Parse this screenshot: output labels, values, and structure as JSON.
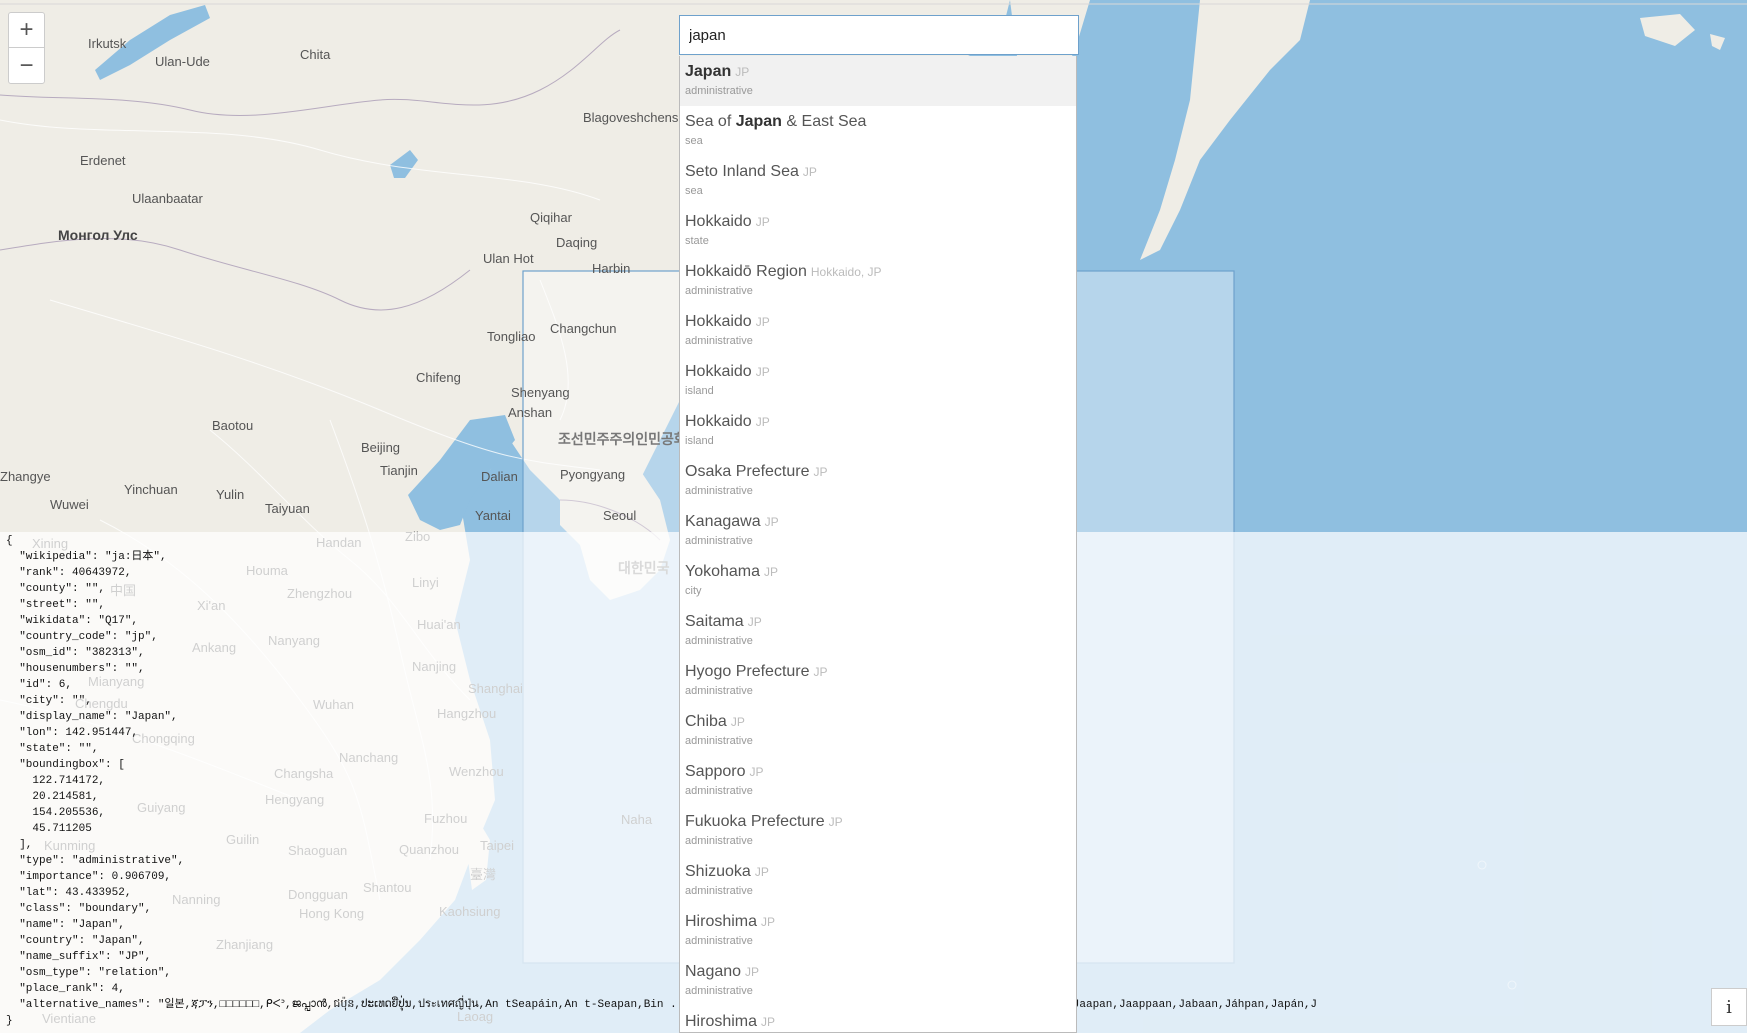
{
  "search": {
    "value": "japan"
  },
  "zoom": {
    "in_label": "+",
    "out_label": "−"
  },
  "info": {
    "label": "i"
  },
  "results": [
    {
      "pre": "",
      "bold": "Japan",
      "post": "",
      "cc": "JP",
      "type": "administrative",
      "active": true
    },
    {
      "pre": "Sea of ",
      "bold": "Japan",
      "post": " & East Sea",
      "cc": "",
      "type": "sea"
    },
    {
      "pre": "Seto Inland Sea",
      "bold": "",
      "post": "",
      "cc": "JP",
      "type": "sea"
    },
    {
      "pre": "Hokkaido",
      "bold": "",
      "post": "",
      "cc": "JP",
      "type": "state"
    },
    {
      "pre": "Hokkaidō Region",
      "bold": "",
      "post": "",
      "cc": "Hokkaido, JP",
      "type": "administrative"
    },
    {
      "pre": "Hokkaido",
      "bold": "",
      "post": "",
      "cc": "JP",
      "type": "administrative"
    },
    {
      "pre": "Hokkaido",
      "bold": "",
      "post": "",
      "cc": "JP",
      "type": "island"
    },
    {
      "pre": "Hokkaido",
      "bold": "",
      "post": "",
      "cc": "JP",
      "type": "island"
    },
    {
      "pre": "Osaka Prefecture",
      "bold": "",
      "post": "",
      "cc": "JP",
      "type": "administrative"
    },
    {
      "pre": "Kanagawa",
      "bold": "",
      "post": "",
      "cc": "JP",
      "type": "administrative"
    },
    {
      "pre": "Yokohama",
      "bold": "",
      "post": "",
      "cc": "JP",
      "type": "city"
    },
    {
      "pre": "Saitama",
      "bold": "",
      "post": "",
      "cc": "JP",
      "type": "administrative"
    },
    {
      "pre": "Hyogo Prefecture",
      "bold": "",
      "post": "",
      "cc": "JP",
      "type": "administrative"
    },
    {
      "pre": "Chiba",
      "bold": "",
      "post": "",
      "cc": "JP",
      "type": "administrative"
    },
    {
      "pre": "Sapporo",
      "bold": "",
      "post": "",
      "cc": "JP",
      "type": "administrative"
    },
    {
      "pre": "Fukuoka Prefecture",
      "bold": "",
      "post": "",
      "cc": "JP",
      "type": "administrative"
    },
    {
      "pre": "Shizuoka",
      "bold": "",
      "post": "",
      "cc": "JP",
      "type": "administrative"
    },
    {
      "pre": "Hiroshima",
      "bold": "",
      "post": "",
      "cc": "JP",
      "type": "administrative"
    },
    {
      "pre": "Nagano",
      "bold": "",
      "post": "",
      "cc": "JP",
      "type": "administrative"
    },
    {
      "pre": "Hiroshima",
      "bold": "",
      "post": "",
      "cc": "JP",
      "type": ""
    }
  ],
  "json_text": "{\n  \"wikipedia\": \"ja:日本\",\n  \"rank\": 40643972,\n  \"county\": \"\",\n  \"street\": \"\",\n  \"wikidata\": \"Q17\",\n  \"country_code\": \"jp\",\n  \"osm_id\": \"382313\",\n  \"housenumbers\": \"\",\n  \"id\": 6,\n  \"city\": \"\",\n  \"display_name\": \"Japan\",\n  \"lon\": 142.951447,\n  \"state\": \"\",\n  \"boundingbox\": [\n    122.714172,\n    20.214581,\n    154.205536,\n    45.711205\n  ],\n  \"type\": \"administrative\",\n  \"importance\": 0.906709,\n  \"lat\": 43.433952,\n  \"class\": \"boundary\",\n  \"name\": \"Japan\",\n  \"country\": \"Japan\",\n  \"name_suffix\": \"JP\",\n  \"osm_type\": \"relation\",\n  \"place_rank\": 4,\n  \"alternative_names\": \"일본,ጃፓን,□□□□□□,ᑭᐸᐣ,ജപ്പാൻ,ជប៉ុន,ປະເທດຍີ່ປຸ່ນ,ประเทศญี่ปุ่น,An tSeapáin,An t-Seapan,Bin ... appone,Giapun,Hapõ,Hapon,Iapani,Iaponia,IJapani,IJaphani,Jaapan,Jaappaan,Jabaan,Jáhpan,Japán,J\n}",
  "map_labels": [
    {
      "t": "Irkutsk"
    },
    {
      "t": "Chita"
    },
    {
      "t": "Ulan-Ude"
    },
    {
      "t": "Blagoveshchensk"
    },
    {
      "t": "Erdenet"
    },
    {
      "t": "Ulaanbaatar"
    },
    {
      "t": "Монгол Улс",
      "big": true
    },
    {
      "t": "Qiqihar"
    },
    {
      "t": "Daqing"
    },
    {
      "t": "Ulan Hot"
    },
    {
      "t": "Harbin"
    },
    {
      "t": "Changchun"
    },
    {
      "t": "Tongliao"
    },
    {
      "t": "Chifeng"
    },
    {
      "t": "Shenyang"
    },
    {
      "t": "Anshan"
    },
    {
      "t": "조선민주주의인민공화",
      "korea": true
    },
    {
      "t": "Baotou"
    },
    {
      "t": "Beijing"
    },
    {
      "t": "Tianjin"
    },
    {
      "t": "Dalian"
    },
    {
      "t": "Pyongyang"
    },
    {
      "t": "Zhangye"
    },
    {
      "t": "Yinchuan"
    },
    {
      "t": "Yulin"
    },
    {
      "t": "Taiyuan"
    },
    {
      "t": "Wuwei"
    },
    {
      "t": "Yantai"
    },
    {
      "t": "Seoul"
    },
    {
      "t": "Xining"
    },
    {
      "t": "Handan"
    },
    {
      "t": "Zibo"
    },
    {
      "t": "Houma"
    },
    {
      "t": "Linyi"
    },
    {
      "t": "대한민국",
      "korea": true
    },
    {
      "t": "中国"
    },
    {
      "t": "Zhengzhou"
    },
    {
      "t": "Xi'an"
    },
    {
      "t": "Huai'an"
    },
    {
      "t": "Ankang"
    },
    {
      "t": "Nanyang"
    },
    {
      "t": "Nanjing"
    },
    {
      "t": "Mianyang"
    },
    {
      "t": "Shanghai"
    },
    {
      "t": "Chengdu"
    },
    {
      "t": "Wuhan"
    },
    {
      "t": "Hangzhou"
    },
    {
      "t": "Chongqing"
    },
    {
      "t": "Nanchang"
    },
    {
      "t": "Changsha"
    },
    {
      "t": "Wenzhou"
    },
    {
      "t": "Hengyang"
    },
    {
      "t": "Guiyang"
    },
    {
      "t": "Fuzhou"
    },
    {
      "t": "Guilin"
    },
    {
      "t": "Kunming"
    },
    {
      "t": "Shaoguan"
    },
    {
      "t": "Quanzhou"
    },
    {
      "t": "Taipei"
    },
    {
      "t": "Shantou"
    },
    {
      "t": "臺灣"
    },
    {
      "t": "Nanning"
    },
    {
      "t": "Dongguan"
    },
    {
      "t": "Hong Kong"
    },
    {
      "t": "Kaohsiung"
    },
    {
      "t": "Zhanjiang"
    },
    {
      "t": "Naha"
    },
    {
      "t": "Vientiane"
    },
    {
      "t": "Laoag"
    }
  ]
}
